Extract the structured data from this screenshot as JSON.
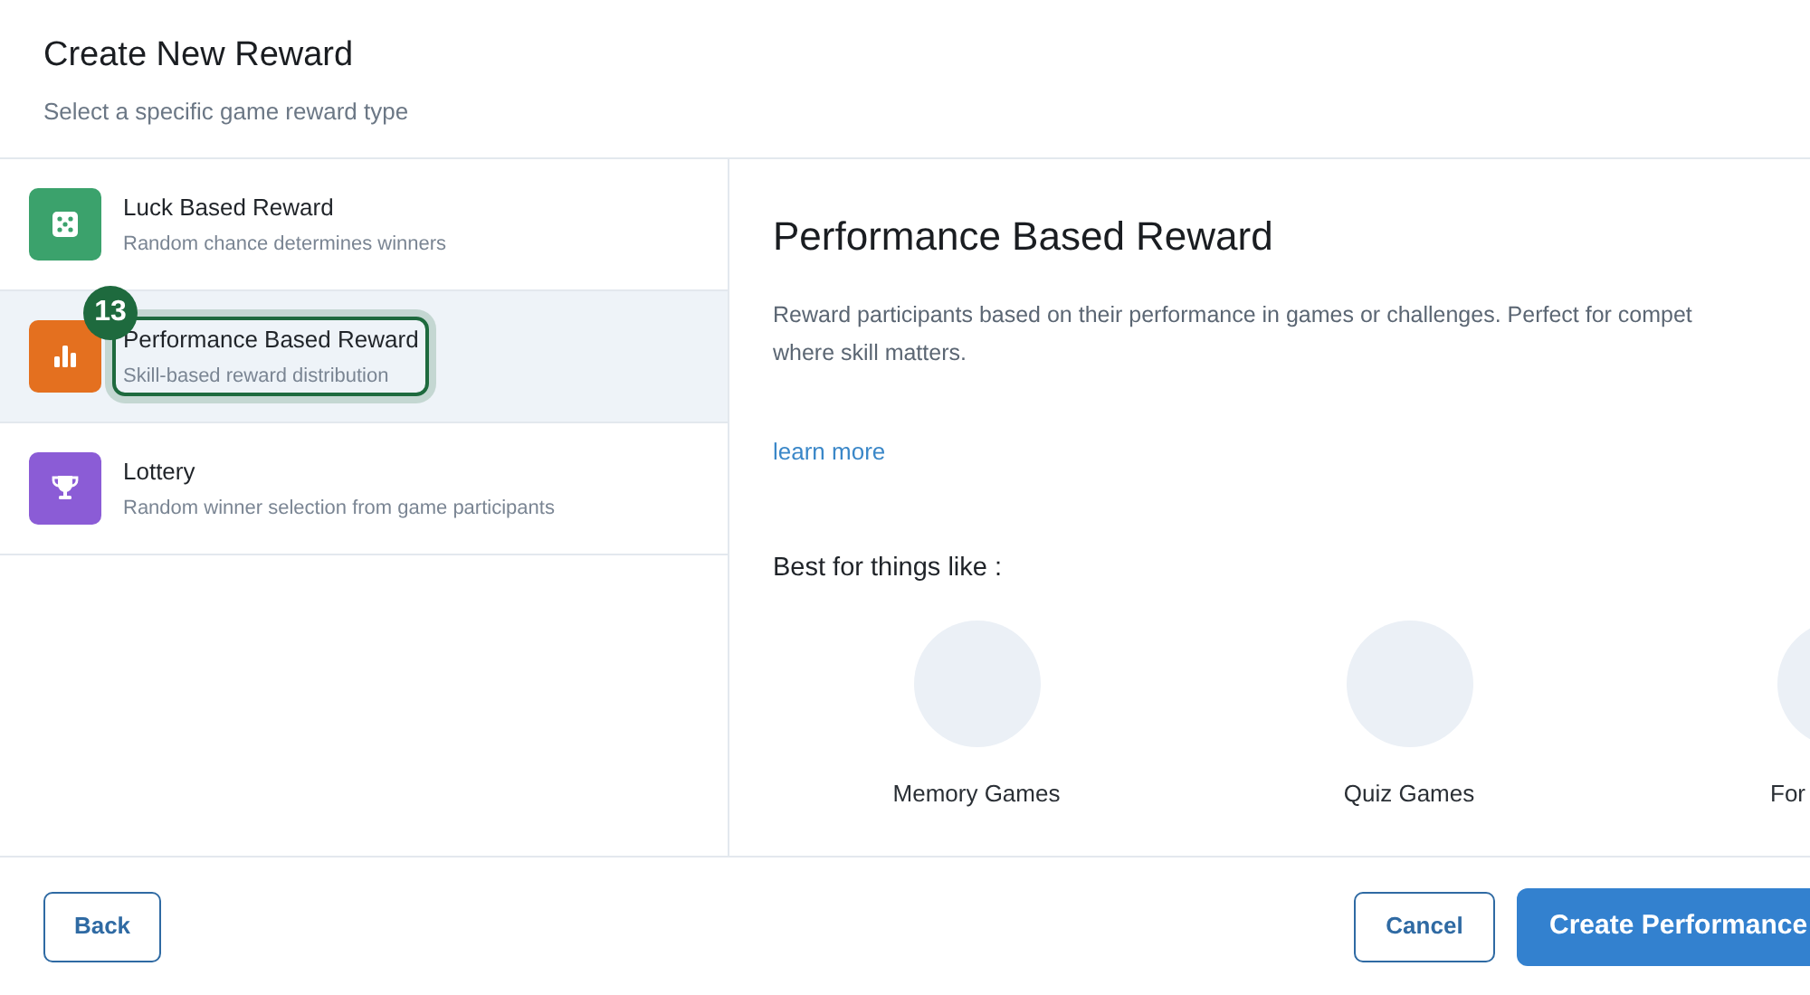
{
  "dialog": {
    "title": "Create New Reward",
    "subtitle": "Select a specific game reward type"
  },
  "reward_types": [
    {
      "kind": "dice",
      "title": "Luck Based Reward",
      "description": "Random chance determines winners",
      "color": "#3ba26c",
      "selected": false
    },
    {
      "kind": "chart",
      "title": "Performance Based Reward",
      "description": "Skill-based reward distribution",
      "color": "#e4701f",
      "selected": true,
      "highlight_badge": "13"
    },
    {
      "kind": "trophy",
      "title": "Lottery",
      "description": "Random winner selection from game participants",
      "color": "#8b5cd6",
      "selected": false
    }
  ],
  "detail": {
    "title": "Performance Based Reward",
    "description_lines": [
      "Reward participants based on their performance in games or challenges. Perfect for compet",
      "where skill matters."
    ],
    "link": "learn more",
    "examples_heading": "Best for things like :",
    "examples": [
      {
        "label": "Memory Games"
      },
      {
        "label": "Quiz Games"
      },
      {
        "label": "For"
      }
    ]
  },
  "footer": {
    "back": "Back",
    "cancel": "Cancel",
    "create": "Create Performance"
  }
}
